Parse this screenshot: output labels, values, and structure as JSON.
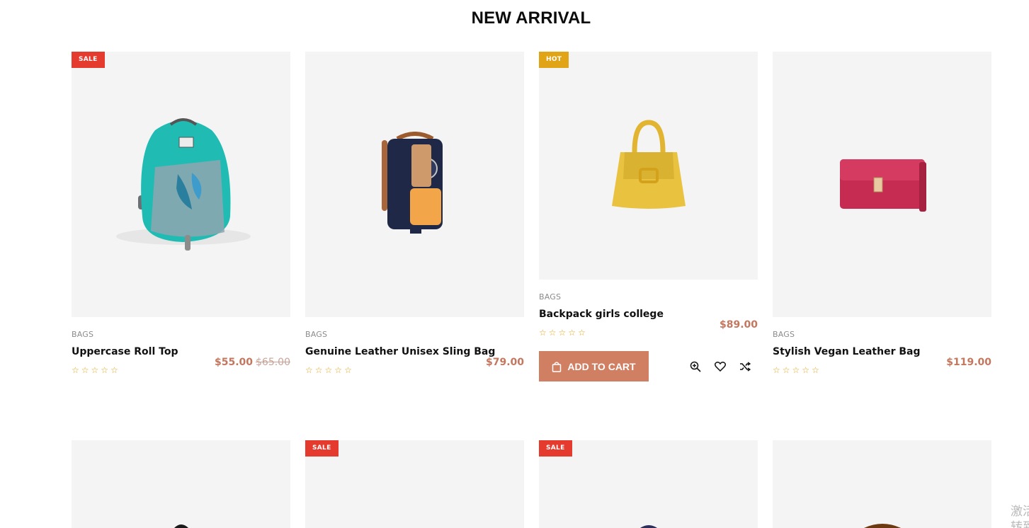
{
  "section": {
    "title": "NEW ARRIVAL"
  },
  "products": [
    {
      "badge": "SALE",
      "category": "BAGS",
      "name": "Uppercase Roll Top",
      "price": "$55.00",
      "old_price": "$65.00",
      "rating": 0
    },
    {
      "badge": "",
      "category": "BAGS",
      "name": "Genuine Leather Unisex Sling Bag",
      "price": "$79.00",
      "old_price": "",
      "rating": 0
    },
    {
      "badge": "HOT",
      "category": "BAGS",
      "name": "Backpack girls college",
      "price": "$89.00",
      "old_price": "",
      "rating": 0,
      "add_to_cart": "ADD TO CART"
    },
    {
      "badge": "",
      "category": "BAGS",
      "name": "Stylish Vegan Leather Bag",
      "price": "$119.00",
      "old_price": "",
      "rating": 0
    }
  ],
  "second_row": [
    {
      "badge": ""
    },
    {
      "badge": "SALE"
    },
    {
      "badge": "SALE"
    },
    {
      "badge": ""
    }
  ],
  "watermark": {
    "text": "激活\n转到"
  },
  "colors": {
    "accent": "#d17f63",
    "price": "#c4775f",
    "sale": "#e53a2e",
    "hot": "#e1a416",
    "star": "#e4a419",
    "thumb_bg": "#f4f4f4"
  },
  "icons": [
    "star-outline-icon",
    "shopping-bag-icon",
    "zoom-in-icon",
    "heart-icon",
    "shuffle-icon"
  ]
}
